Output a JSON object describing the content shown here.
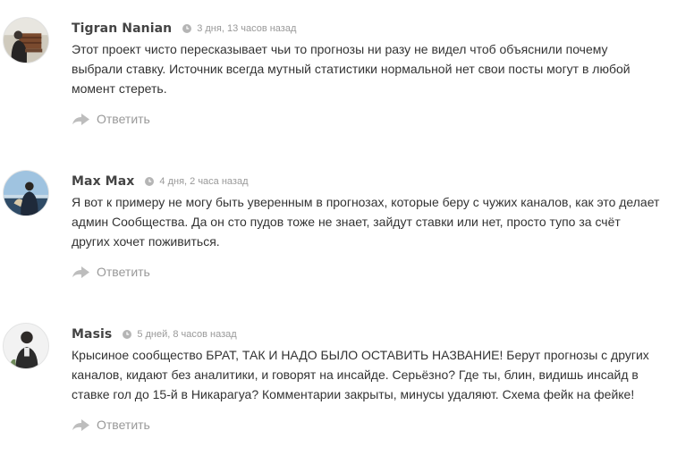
{
  "comments": [
    {
      "author": "Tigran Nanian",
      "time": "3 дня, 13 часов назад",
      "lines": [
        "Этот проект чисто пересказывает чьи то прогнозы ни разу не видел чтоб объяснили почему",
        "выбрали ставку. Источник всегда мутный статистики нормальной нет свои посты могут в любой",
        "момент стереть."
      ],
      "reply_label": "Ответить"
    },
    {
      "author": "Max Max",
      "time": "4 дня, 2 часа назад",
      "lines": [
        "Я вот к примеру не могу быть уверенным в прогнозах, которые беру с чужих каналов, как это делает",
        "админ Сообщества. Да он сто пудов тоже не знает, зайдут ставки или нет, просто тупо за счёт",
        "других хочет поживиться."
      ],
      "reply_label": "Ответить"
    },
    {
      "author": "Masis",
      "time": "5 дней, 8 часов назад",
      "lines": [
        "Крысиное сообщество БРАТ, ТАК И НАДО БЫЛО ОСТАВИТЬ НАЗВАНИЕ! Берут прогнозы с других",
        "каналов, кидают без аналитики, и говорят на инсайде. Серьёзно? Где ты, блин, видишь инсайд в",
        "ставке гол до 15-й в Никарагуа? Комментарии закрыты, минусы удаляют. Схема фейк на фейке!"
      ],
      "reply_label": "Ответить"
    }
  ],
  "icons": {
    "clock": "clock-icon",
    "reply": "reply-arrow-icon",
    "avatar": "user-avatar"
  },
  "colors": {
    "author": "#444444",
    "meta": "#999999",
    "text": "#333333"
  }
}
